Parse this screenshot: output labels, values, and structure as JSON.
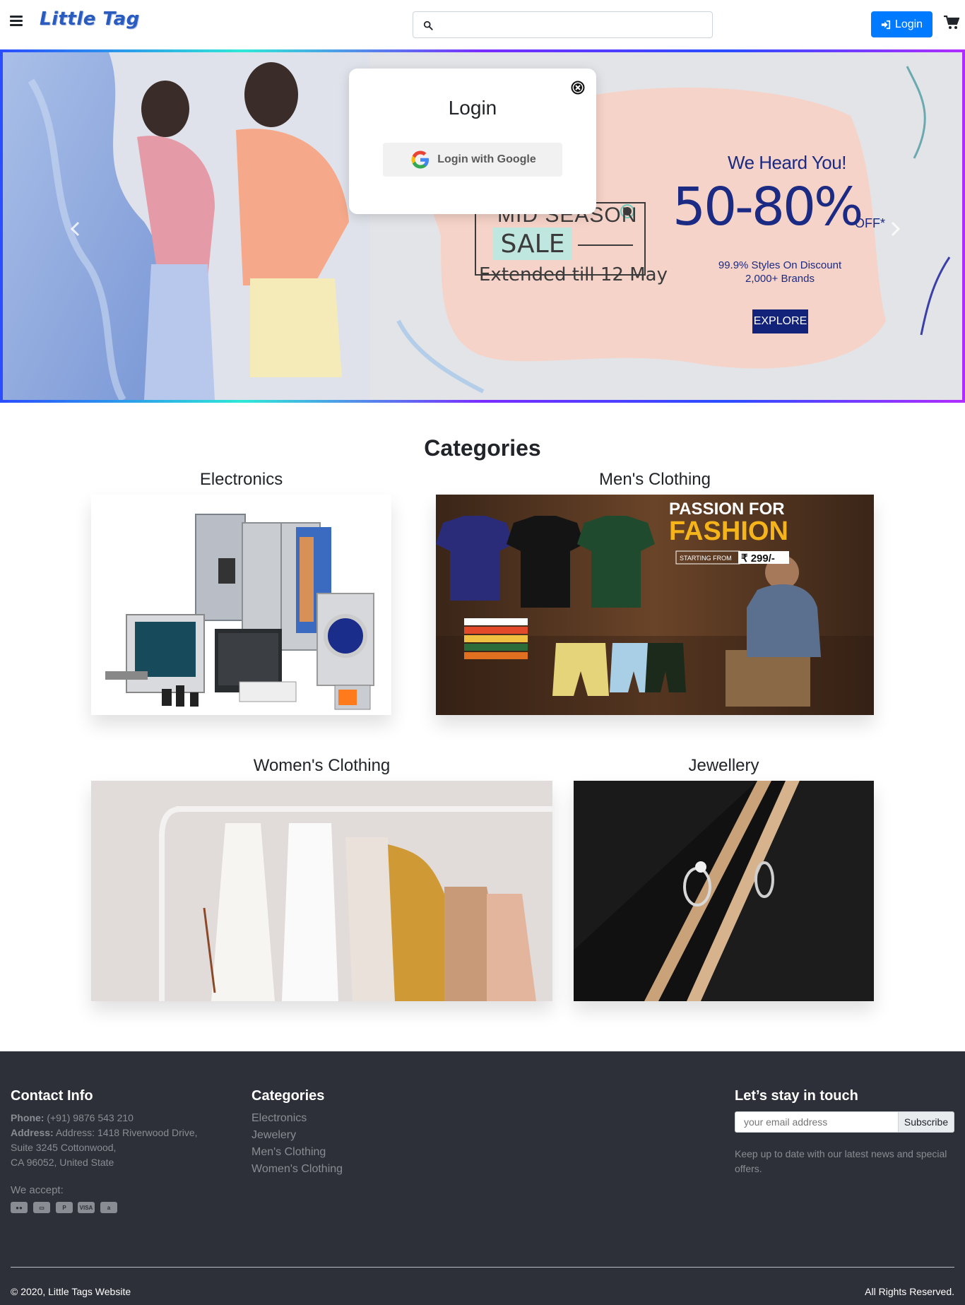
{
  "navbar": {
    "brand": "Little Tag",
    "search_placeholder": "",
    "login_label": "Login"
  },
  "hero": {
    "sale_top": "MID SEASON",
    "sale_label": "SALE",
    "extended": "Extended till 12 May",
    "heard": "We Heard You!",
    "discount": "50-80%",
    "discount_suffix": "OFF*",
    "styles_line1": "99.9% Styles On Discount",
    "styles_line2": "2,000+ Brands",
    "explore": "EXPLORE"
  },
  "modal": {
    "title": "Login",
    "google_label": "Login with Google"
  },
  "categories": {
    "heading": "Categories",
    "items": [
      {
        "title": "Electronics"
      },
      {
        "title": "Men's Clothing"
      },
      {
        "title": "Women's Clothing"
      },
      {
        "title": "Jewellery"
      }
    ],
    "mens_banner": {
      "line1": "PASSION FOR",
      "line2": "FASHION",
      "starting": "STARTING FROM",
      "price": "₹ 299/-"
    }
  },
  "footer": {
    "contact_heading": "Contact Info",
    "phone_label": "Phone:",
    "phone_value": "(+91) 9876 543 210",
    "address_label": "Address:",
    "address_line1": "Address: 1418 Riverwood Drive,",
    "address_line2": "Suite 3245 Cottonwood,",
    "address_line3": "CA 96052, United State",
    "accept_label": "We accept:",
    "payment_icons": [
      "mastercard-icon",
      "credit-card-icon",
      "paypal-icon",
      "visa-icon",
      "amazon-pay-icon"
    ],
    "categories_heading": "Categories",
    "category_links": [
      "Electronics",
      "Jewelery",
      "Men's Clothing",
      "Women's Clothing"
    ],
    "touch_heading": "Let’s stay in touch",
    "email_placeholder": "your email address",
    "subscribe_label": "Subscribe",
    "touch_text_line1": "Keep up to date with our latest news and special",
    "touch_text_line2": "offers.",
    "copyright": "© 2020, Little Tags Website",
    "rights": "All Rights Reserved."
  },
  "colors": {
    "primary": "#007bff",
    "brand": "#2a5bbf",
    "footer_bg": "#2e3039",
    "hero_accent": "#1b2a82"
  }
}
